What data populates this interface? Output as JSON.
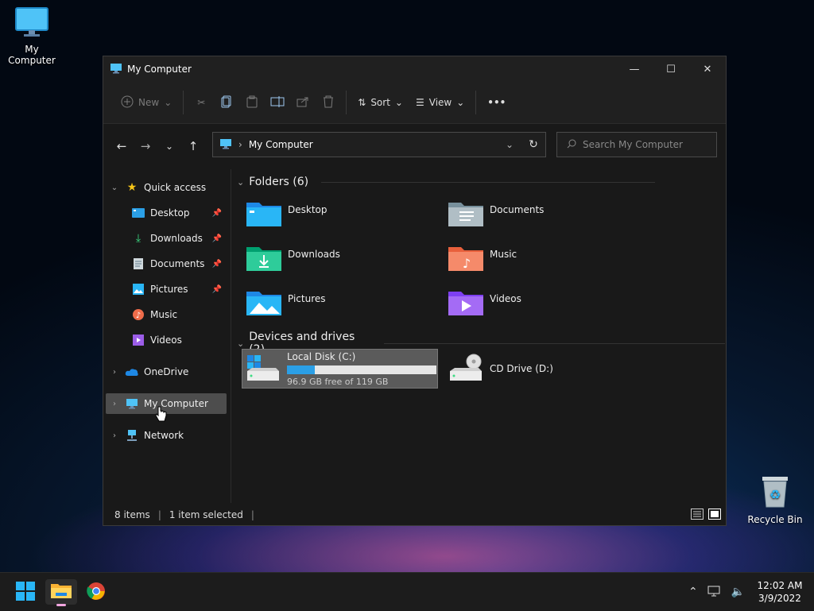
{
  "desktop": {
    "icons": [
      {
        "label": "My Computer"
      },
      {
        "label": "Recycle Bin"
      }
    ]
  },
  "window": {
    "title": "My Computer",
    "controls": {
      "minimize": "—",
      "maximize": "☐",
      "close": "✕"
    }
  },
  "ribbon": {
    "new_label": "New",
    "sort_label": "Sort",
    "view_label": "View",
    "more_label": "•••"
  },
  "address": {
    "path": "My Computer",
    "search_placeholder": "Search My Computer"
  },
  "sidebar": {
    "quick_access": "Quick access",
    "items": [
      {
        "label": "Desktop",
        "pinned": true
      },
      {
        "label": "Downloads",
        "pinned": true
      },
      {
        "label": "Documents",
        "pinned": true
      },
      {
        "label": "Pictures",
        "pinned": true
      },
      {
        "label": "Music",
        "pinned": false
      },
      {
        "label": "Videos",
        "pinned": false
      }
    ],
    "onedrive": "OneDrive",
    "my_computer": "My Computer",
    "network": "Network"
  },
  "content": {
    "folders_header": "Folders (6)",
    "folders": [
      {
        "label": "Desktop"
      },
      {
        "label": "Documents"
      },
      {
        "label": "Downloads"
      },
      {
        "label": "Music"
      },
      {
        "label": "Pictures"
      },
      {
        "label": "Videos"
      }
    ],
    "drives_header": "Devices and drives (2)",
    "drives": [
      {
        "label": "Local Disk (C:)",
        "free_text": "96.9 GB free of 119 GB",
        "used_fraction": 0.186
      },
      {
        "label": "CD Drive (D:)"
      }
    ]
  },
  "status": {
    "items": "8 items",
    "selected": "1 item selected"
  },
  "taskbar": {
    "time": "12:02 AM",
    "date": "3/9/2022"
  },
  "colors": {
    "accent": "#2b9fe6",
    "window_bg": "#191919",
    "selected_bg": "#4d4d4d"
  }
}
